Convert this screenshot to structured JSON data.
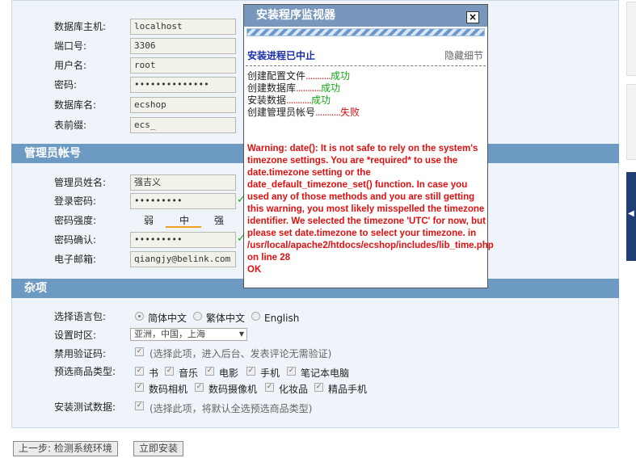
{
  "database": {
    "host": {
      "label": "数据库主机:",
      "value": "localhost"
    },
    "port": {
      "label": "端口号:",
      "value": "3306"
    },
    "user": {
      "label": "用户名:",
      "value": "root"
    },
    "password": {
      "label": "密码:",
      "value": "••••••••••••••"
    },
    "name": {
      "label": "数据库名:",
      "value": "ecshop"
    },
    "prefix": {
      "label": "表前缀:",
      "value": "ecs_"
    }
  },
  "admin": {
    "section_title": "管理员帐号",
    "name": {
      "label": "管理员姓名:",
      "value": "强吉义"
    },
    "password": {
      "label": "登录密码:",
      "value": "•••••••••"
    },
    "strength": {
      "label": "密码强度:",
      "weak": "弱",
      "medium": "中",
      "strong": "强",
      "level": "中"
    },
    "confirm": {
      "label": "密码确认:",
      "value": "•••••••••"
    },
    "email": {
      "label": "电子邮箱:",
      "value": "qiangjy@belink.com"
    },
    "valid_mark": "✓"
  },
  "misc": {
    "section_title": "杂项",
    "language": {
      "label": "选择语言包:",
      "options": [
        "简体中文",
        "繁体中文",
        "English"
      ],
      "selected": "简体中文"
    },
    "timezone": {
      "label": "设置时区:",
      "value": "亚洲，中国，上海"
    },
    "captcha": {
      "label": "禁用验证码:",
      "note": "(选择此项，进入后台、发表评论无需验证)",
      "checked": true
    },
    "goods_types": {
      "label": "预选商品类型:",
      "items": [
        "书",
        "音乐",
        "电影",
        "手机",
        "笔记本电脑",
        "数码相机",
        "数码摄像机",
        "化妆品",
        "精品手机"
      ]
    },
    "test_data": {
      "label": "安装测试数据:",
      "note": "(选择此项，将默认全选预选商品类型)",
      "checked": true
    }
  },
  "buttons": {
    "prev": "上一步: 检测系统环境",
    "install": "立即安装"
  },
  "popup": {
    "title": "安装程序监视器",
    "close": "×",
    "status": "安装进程已中止",
    "hide_details": "隐藏细节",
    "steps": [
      {
        "name": "创建配置文件",
        "dots": "...........",
        "result": "成功",
        "ok": true
      },
      {
        "name": "创建数据库",
        "dots": "...........",
        "result": "成功",
        "ok": true
      },
      {
        "name": "安装数据",
        "dots": "...........",
        "result": "成功",
        "ok": true
      },
      {
        "name": "创建管理员帐号",
        "dots": "...........",
        "result": "失败",
        "ok": false
      }
    ],
    "warning": "Warning: date(): It is not safe to rely on the system's timezone settings. You are *required* to use the date.timezone setting or the date_default_timezone_set() function. In case you used any of those methods and you are still getting this warning, you most likely misspelled the timezone identifier. We selected the timezone 'UTC' for now, but please set date.timezone to select your timezone. in /usr/local/apache2/htdocs/ecshop/includes/lib_time.php on line 28\nOK"
  },
  "colors": {
    "section_header": "#6d9ac2",
    "popup_title_bg": "#7797bd",
    "warning": "#e01010",
    "success": "#14a414"
  }
}
